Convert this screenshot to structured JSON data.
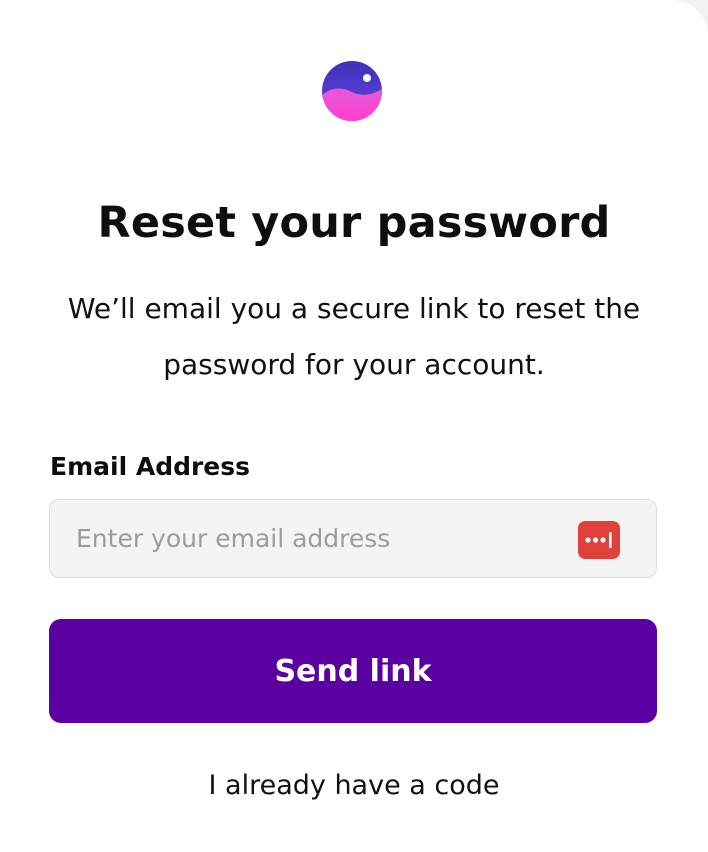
{
  "colors": {
    "primary_button": "#5a00a0",
    "logo_top": "#4b3fc8",
    "logo_bottom": "#ff4fd8",
    "pw_manager_icon": "#e0413a"
  },
  "header": {
    "logo_icon": "app-logo-icon",
    "title": "Reset your password",
    "subtitle": "We’ll email you a secure link to reset the password for your account."
  },
  "form": {
    "email_label": "Email Address",
    "email_value": "",
    "email_placeholder": "Enter your email address",
    "password_manager_icon": "password-manager-icon",
    "submit_label": "Send link"
  },
  "footer": {
    "code_link": "I already have a code"
  }
}
